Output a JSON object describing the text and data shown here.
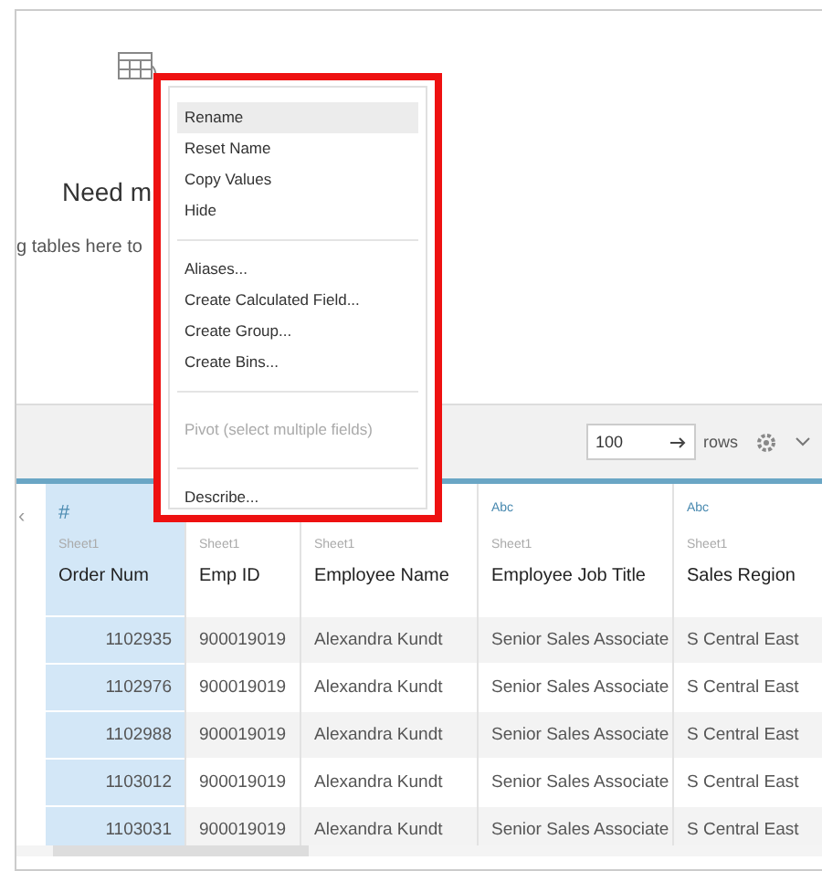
{
  "canvas": {
    "heading": "Need m",
    "hint": "g tables here to"
  },
  "gutter": {
    "toggle": "‹"
  },
  "toolbar": {
    "rows_value": "100",
    "rows_label": "rows"
  },
  "table": {
    "columns": [
      {
        "kind": "number",
        "type_label": "#",
        "source": "Sheet1",
        "name": "Order Num",
        "selected": true
      },
      {
        "kind": "text",
        "source": "Sheet1",
        "name": "Emp ID",
        "selected": false
      },
      {
        "kind": "text",
        "source": "Sheet1",
        "name": "Employee Name",
        "selected": false
      },
      {
        "kind": "text",
        "type_label": "Abc",
        "source": "Sheet1",
        "name": "Employee Job Title",
        "selected": false
      },
      {
        "kind": "text",
        "type_label": "Abc",
        "source": "Sheet1",
        "name": "Sales Region",
        "selected": false
      }
    ],
    "rows": [
      [
        "1102935",
        "900019019",
        "Alexandra Kundt",
        "Senior Sales Associate",
        "S Central East"
      ],
      [
        "1102976",
        "900019019",
        "Alexandra Kundt",
        "Senior Sales Associate",
        "S Central East"
      ],
      [
        "1102988",
        "900019019",
        "Alexandra Kundt",
        "Senior Sales Associate",
        "S Central East"
      ],
      [
        "1103012",
        "900019019",
        "Alexandra Kundt",
        "Senior Sales Associate",
        "S Central East"
      ],
      [
        "1103031",
        "900019019",
        "Alexandra Kundt",
        "Senior Sales Associate",
        "S Central East"
      ]
    ]
  },
  "context_menu": {
    "groups": [
      [
        {
          "label": "Rename",
          "selected": true,
          "disabled": false
        },
        {
          "label": "Reset Name",
          "selected": false,
          "disabled": false
        },
        {
          "label": "Copy Values",
          "selected": false,
          "disabled": false
        },
        {
          "label": "Hide",
          "selected": false,
          "disabled": false
        }
      ],
      [
        {
          "label": "Aliases...",
          "selected": false,
          "disabled": false
        },
        {
          "label": "Create Calculated Field...",
          "selected": false,
          "disabled": false
        },
        {
          "label": "Create Group...",
          "selected": false,
          "disabled": false
        },
        {
          "label": "Create Bins...",
          "selected": false,
          "disabled": false
        }
      ],
      [
        {
          "label": "Pivot (select multiple fields)",
          "selected": false,
          "disabled": true
        }
      ],
      [
        {
          "label": "Describe...",
          "selected": false,
          "disabled": false
        }
      ]
    ]
  }
}
